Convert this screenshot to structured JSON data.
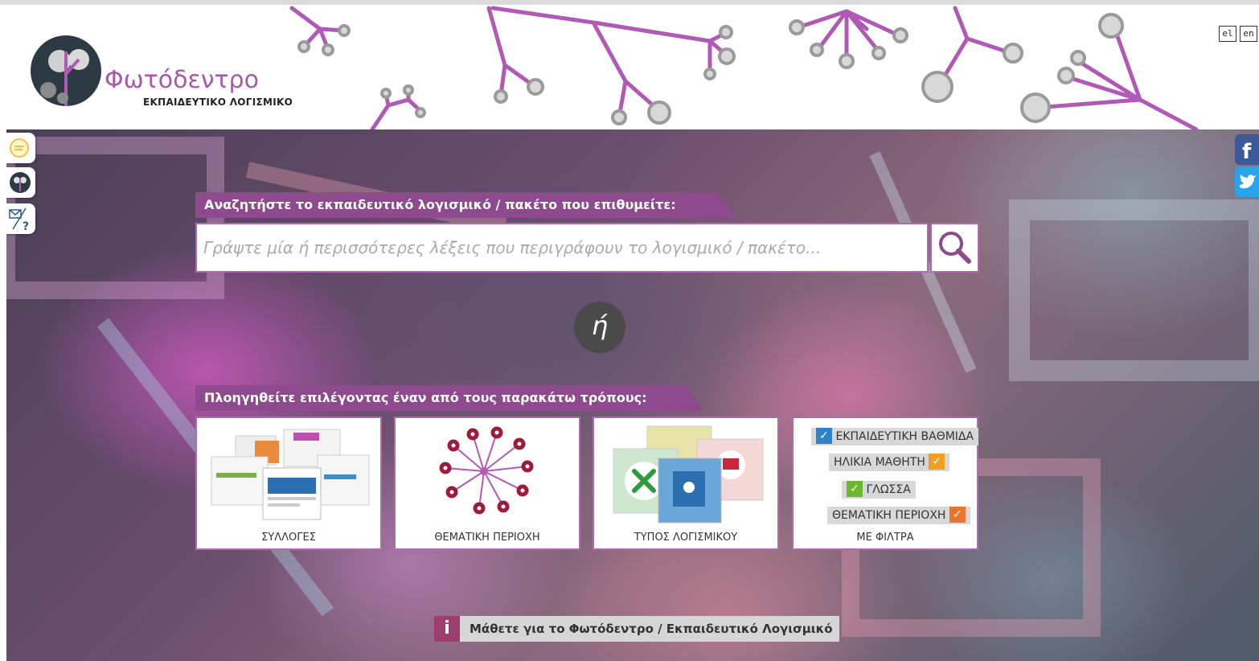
{
  "header": {
    "brand_name": "Φωτόδεντρο",
    "brand_subtitle": "ΕΚΠΑΙΔΕΥΤΙΚΟ ΛΟΓΙΣΜΙΚΟ",
    "languages": [
      "el",
      "en"
    ]
  },
  "search": {
    "heading": "Αναζητήστε το εκπαιδευτικό λογισμικό / πακέτο που επιθυμείτε:",
    "placeholder": "Γράψτε μία ή περισσότερες λέξεις που περιγράφουν το λογισμικό / πακέτο...",
    "or_label": "ή"
  },
  "browse": {
    "heading": "Πλοηγηθείτε επιλέγοντας έναν από τους παρακάτω τρόπους:",
    "cards": [
      {
        "label": "ΣΥΛΛΟΓΕΣ"
      },
      {
        "label": "ΘΕΜΑΤΙΚΗ ΠΕΡΙΟΧΗ"
      },
      {
        "label": "ΤΥΠΟΣ ΛΟΓΙΣΜΙΚΟΥ"
      },
      {
        "label": "ΜΕ ΦΙΛΤΡΑ"
      }
    ],
    "filters": [
      {
        "label": "ΕΚΠΑΙΔΕΥΤΙΚΗ ΒΑΘΜΙΔΑ",
        "color": "#2f82c8"
      },
      {
        "label": "ΗΛΙΚΙΑ ΜΑΘΗΤΗ",
        "color": "#f0a020"
      },
      {
        "label": "ΓΛΩΣΣΑ",
        "color": "#6ab82c"
      },
      {
        "label": "ΘΕΜΑΤΙΚΗ ΠΕΡΙΟΧΗ",
        "color": "#e8762a"
      }
    ]
  },
  "info": {
    "text": "Μάθετε για το Φωτόδεντρο / Εκπαιδευτικό Λογισμικό",
    "icon": "i"
  },
  "colors": {
    "accent": "#8d4a8d",
    "branch": "#b05ab5"
  }
}
